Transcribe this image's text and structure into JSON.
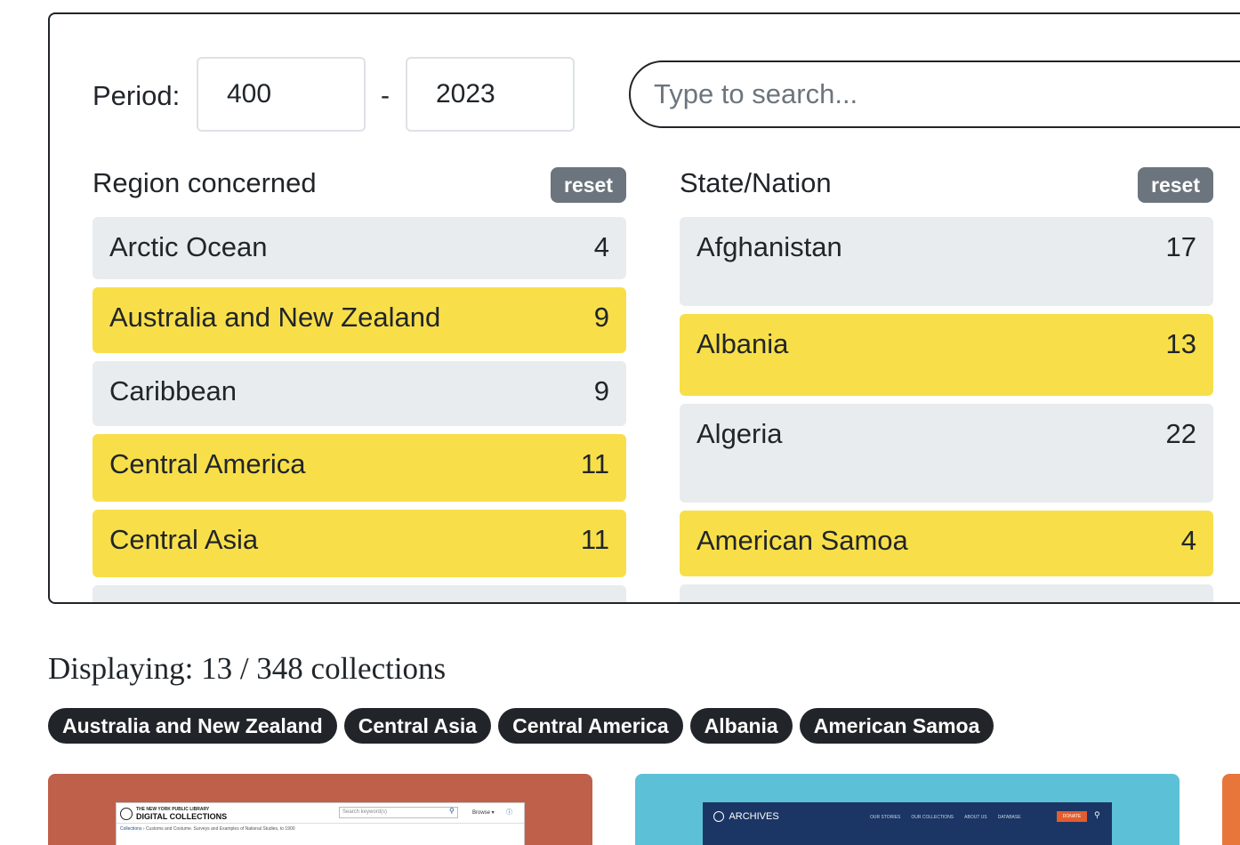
{
  "period": {
    "label": "Period:",
    "separator": "-",
    "from_value": "400",
    "to_value": "2023"
  },
  "search": {
    "placeholder": "Type to search..."
  },
  "facets": {
    "region": {
      "title": "Region concerned",
      "reset_label": "reset",
      "items": [
        {
          "label": "Arctic Ocean",
          "count": "4",
          "selected": false
        },
        {
          "label": "Australia and New Zealand",
          "count": "9",
          "selected": true
        },
        {
          "label": "Caribbean",
          "count": "9",
          "selected": false
        },
        {
          "label": "Central America",
          "count": "11",
          "selected": true
        },
        {
          "label": "Central Asia",
          "count": "11",
          "selected": true
        }
      ]
    },
    "state": {
      "title": "State/Nation",
      "reset_label": "reset",
      "items": [
        {
          "label": "Afghanistan",
          "count": "17",
          "selected": false
        },
        {
          "label": "Albania",
          "count": "13",
          "selected": true
        },
        {
          "label": "Algeria",
          "count": "22",
          "selected": false
        },
        {
          "label": "American Samoa",
          "count": "4",
          "selected": true
        }
      ]
    }
  },
  "results": {
    "displaying": "Displaying: 13 / 348 collections"
  },
  "active_filters": [
    "Australia and New Zealand",
    "Central Asia",
    "Central America",
    "Albania",
    "American Samoa"
  ],
  "cards": {
    "nypl": {
      "org": "THE NEW YORK PUBLIC LIBRARY",
      "title": "DIGITAL COLLECTIONS",
      "search_placeholder": "Search keyword(s)",
      "browse": "Browse ▾",
      "crumb_link": "Collections",
      "crumb_text": "Customs and Costume. Surveys and Examples of National Studies, to 1900"
    },
    "archives": {
      "logo_text": "ARCHIVES",
      "nav": [
        "OUR STORIES",
        "OUR COLLECTIONS",
        "ABOUT US",
        "DATABASE"
      ],
      "donate": "DONATE"
    }
  },
  "colors": {
    "selected": "#f8df4a",
    "unselected": "#e9ecef",
    "chip": "#212529",
    "reset": "#6c757d",
    "card_1": "#bf604b",
    "card_2": "#5cc1d7",
    "card_3": "#e8763a"
  }
}
